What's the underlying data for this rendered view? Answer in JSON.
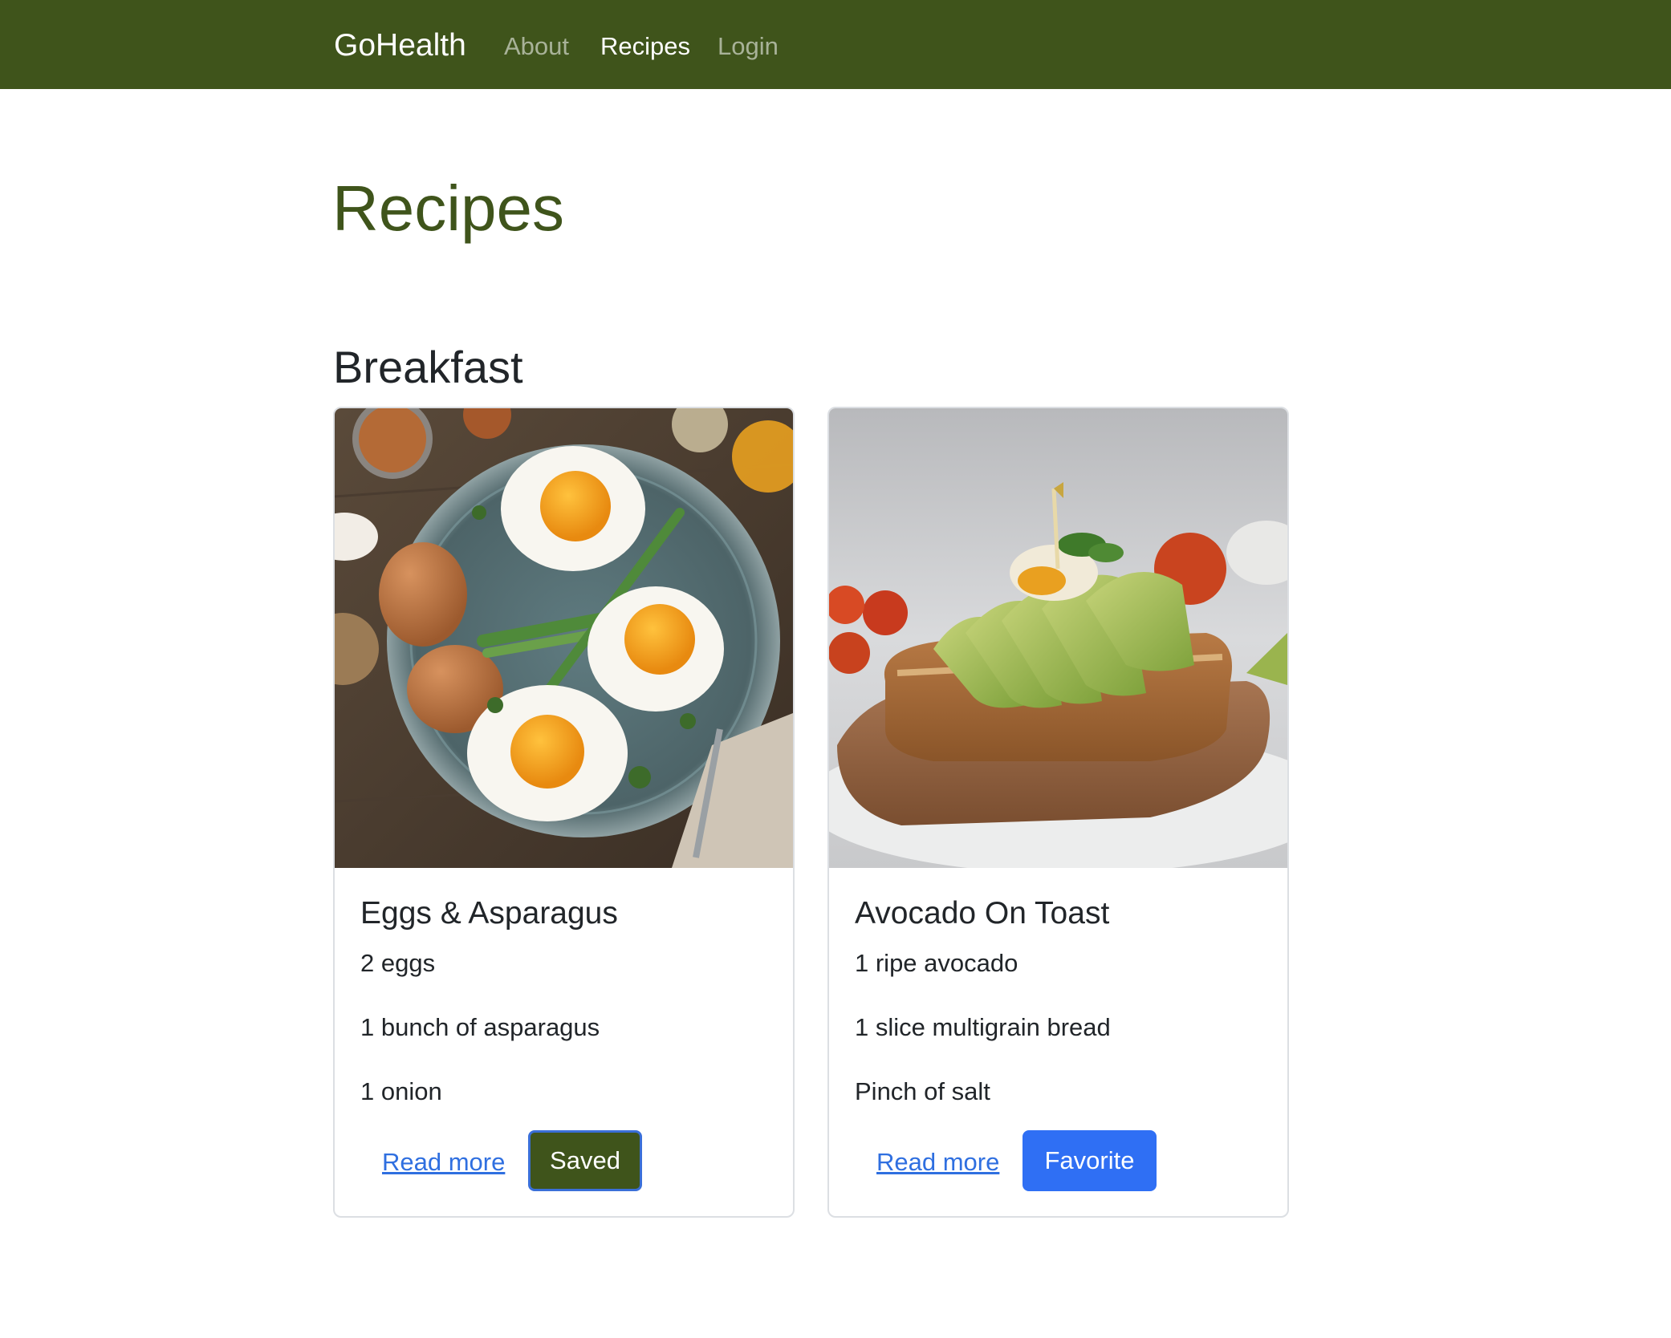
{
  "navbar": {
    "brand": "GoHealth",
    "links": [
      {
        "label": "About",
        "active": false
      },
      {
        "label": "Recipes",
        "active": true
      },
      {
        "label": "Login",
        "active": false
      }
    ],
    "background": "#3f541b"
  },
  "page": {
    "title": "Recipes",
    "title_color": "#3f541b"
  },
  "sections": [
    {
      "title": "Breakfast",
      "recipes": [
        {
          "image": "eggs-asparagus-photo",
          "title": "Eggs & Asparagus",
          "ingredients": [
            "2 eggs",
            "1 bunch of asparagus",
            "1 onion"
          ],
          "read_more": "Read more",
          "action_label": "Saved",
          "action_color": "#3f541b"
        },
        {
          "image": "avocado-toast-photo",
          "title": "Avocado On Toast",
          "ingredients": [
            "1 ripe avocado",
            "1 slice multigrain bread",
            "Pinch of salt"
          ],
          "read_more": "Read more",
          "action_label": "Favorite",
          "action_color": "#2f6ff4"
        }
      ]
    }
  ]
}
